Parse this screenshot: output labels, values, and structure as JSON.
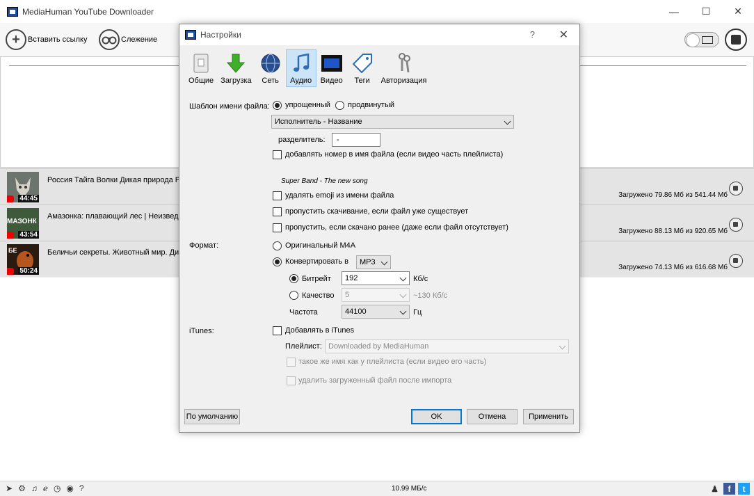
{
  "app": {
    "title": "MediaHuman YouTube Downloader"
  },
  "toolbar": {
    "paste_label": "Вставить ссылку",
    "track_label": "Слежение"
  },
  "downloads": [
    {
      "title": "Россия Тайга Волки Дикая природа Р",
      "duration": "44:45",
      "status": "Загружено 79.86 Мб из 541.44 Мб",
      "thumb_text": ""
    },
    {
      "title": "Амазонка: плавающий лес | Неизвед",
      "duration": "43:54",
      "status": "Загружено 88.13 Мб из 920.65 Мб",
      "thumb_text": "МАЗОНК"
    },
    {
      "title": "Беличьи секреты.  Животный мир. Ди",
      "duration": "50:24",
      "status": "Загружено 74.13 Мб из 616.68 Мб",
      "thumb_text": "БЕ"
    }
  ],
  "statusbar": {
    "speed": "10.99 МБ/с"
  },
  "dialog": {
    "title": "Настройки",
    "help": "?",
    "tabs": [
      "Общие",
      "Загрузка",
      "Сеть",
      "Аудио",
      "Видео",
      "Теги",
      "Авторизация"
    ],
    "active_tab": "Аудио",
    "filename_label": "Шаблон имени файла:",
    "simple_label": "упрощенный",
    "advanced_label": "продвинутый",
    "template_value": "Исполнитель - Название",
    "separator_label": "разделитель:",
    "separator_value": "-",
    "add_number_label": "добавлять номер в имя файла (если видео часть плейлиста)",
    "preview": "Super Band - The new song",
    "remove_emoji_label": "удалять emoji из имени файла",
    "skip_exists_label": "пропустить скачивание, если файл уже существует",
    "skip_downloaded_label": "пропустить, если скачано ранее (даже если файл отсутствует)",
    "format_label": "Формат:",
    "original_label": "Оригинальный M4A",
    "convert_label": "Конвертировать в",
    "convert_value": "MP3",
    "bitrate_label": "Битрейт",
    "bitrate_value": "192",
    "bitrate_unit": "Кб/с",
    "quality_label": "Качество",
    "quality_value": "5",
    "quality_unit": "~130 Кб/с",
    "frequency_label": "Частота",
    "frequency_value": "44100",
    "frequency_unit": "Гц",
    "itunes_label": "iTunes:",
    "add_itunes_label": "Добавлять в iTunes",
    "playlist_label": "Плейлист:",
    "playlist_value": "Downloaded by MediaHuman",
    "same_name_label": "такое же имя как у плейлиста (если видео его часть)",
    "delete_after_label": "удалить загруженный файл после импорта",
    "default_button": "По умолчанию",
    "ok_button": "OK",
    "cancel_button": "Отмена",
    "apply_button": "Применить"
  }
}
